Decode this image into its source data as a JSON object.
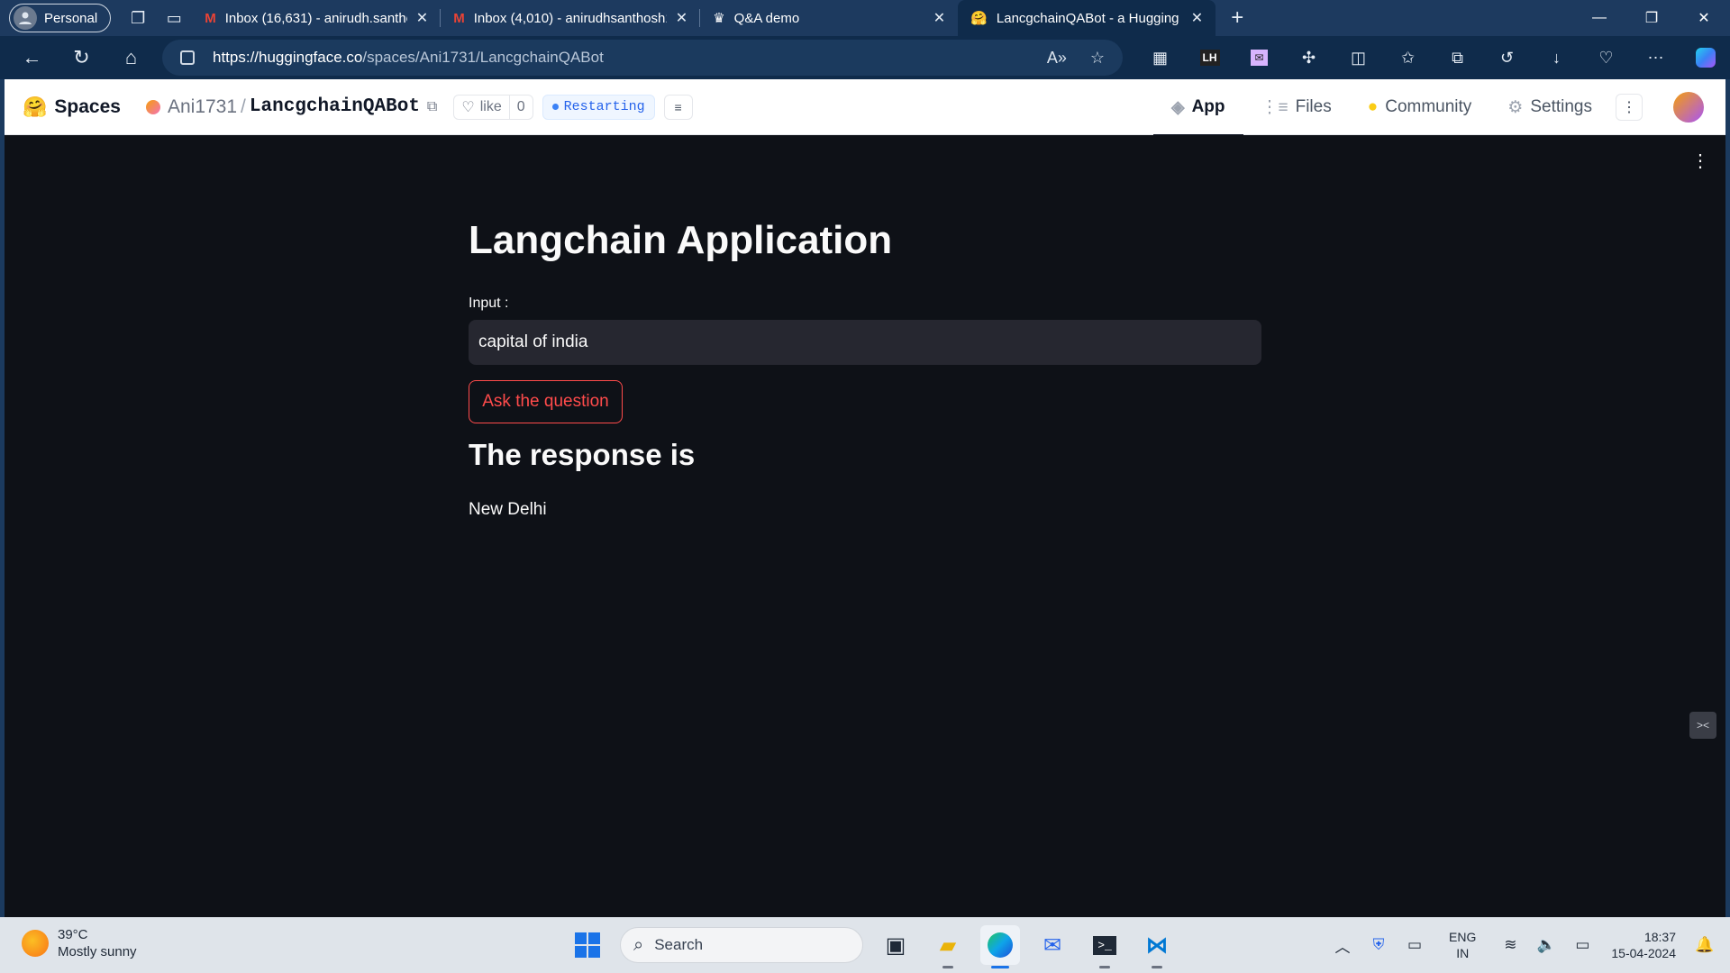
{
  "browser": {
    "profile_label": "Personal",
    "tabs": [
      {
        "title": "Inbox (16,631) - anirudh.santhosh",
        "favicon": "gmail-icon"
      },
      {
        "title": "Inbox (4,010) - anirudhsanthosh1",
        "favicon": "gmail-icon"
      },
      {
        "title": "Q&A demo",
        "favicon": "crown-icon"
      },
      {
        "title": "LancgchainQABot - a Hugging Fa",
        "favicon": "hugging-face-icon",
        "active": true
      }
    ],
    "url_host": "https://huggingface.co",
    "url_path": "/spaces/Ani1731/LancgchainQABot"
  },
  "hf": {
    "brand": "Spaces",
    "owner": "Ani1731",
    "separator": "/",
    "repo": "LancgchainQABot",
    "like_label": "like",
    "like_count": "0",
    "status": "Restarting",
    "nav": {
      "app": "App",
      "files": "Files",
      "community": "Community",
      "settings": "Settings"
    }
  },
  "app": {
    "title": "Langchain Application",
    "input_label": "Input :",
    "input_value": "capital of india",
    "button_label": "Ask the question",
    "response_heading": "The response is",
    "response_text": "New Delhi"
  },
  "taskbar": {
    "temperature": "39°C",
    "weather": "Mostly sunny",
    "search_placeholder": "Search",
    "lang_line1": "ENG",
    "lang_line2": "IN",
    "time": "18:37",
    "date": "15-04-2024"
  },
  "colors": {
    "app_bg": "#0e1117",
    "accent_red": "#ff4b4b",
    "input_bg": "#262730",
    "browser_frame": "#1d3a5f"
  }
}
